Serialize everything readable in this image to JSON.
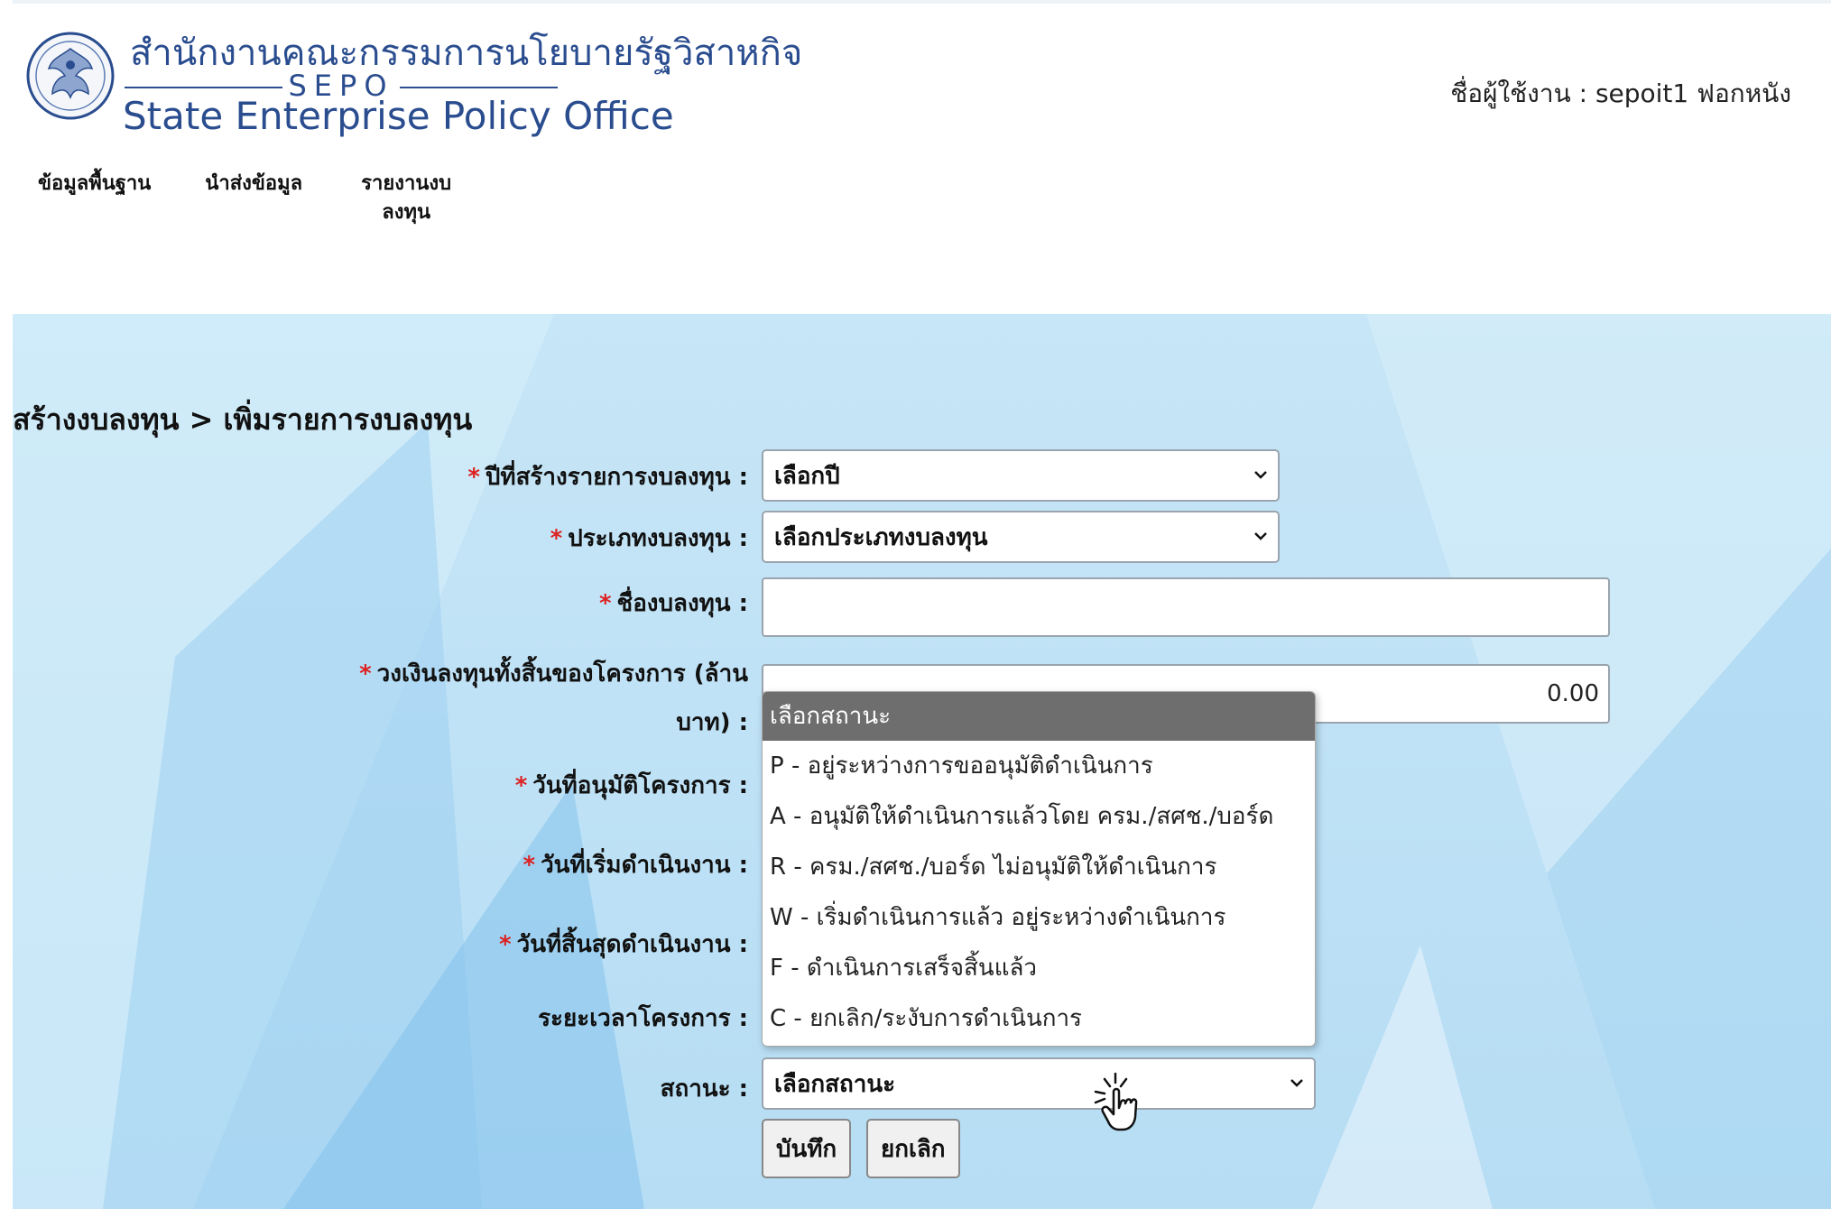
{
  "header": {
    "logo_thai": "สำนักงานคณะกรรมการนโยบายรัฐวิสาหกิจ",
    "logo_sepo": "SEPO",
    "logo_english": "State Enterprise Policy Office",
    "user_label": "ชื่อผู้ใช้งาน : sepoit1 ฟอกหนัง"
  },
  "nav": {
    "items": [
      {
        "label": "ข้อมูลพื้นฐาน"
      },
      {
        "label": "นำส่งข้อมูล"
      },
      {
        "label_line1": "รายงานงบ",
        "label_line2": "ลงทุน"
      }
    ]
  },
  "breadcrumb": "สร้างงบลงทุน > เพิ่มรายการงบลงทุน",
  "form": {
    "required_mark": "*",
    "year_label": "ปีที่สร้างรายการงบลงทุน :",
    "year_value": "เลือกปี",
    "type_label": "ประเภทงบลงทุน :",
    "type_value": "เลือกประเภทงบลงทุน",
    "name_label": "ชื่องบลงทุน :",
    "name_value": "",
    "budget_label_line1": "วงเงินลงทุนทั้งสิ้นของโครงการ (ล้าน",
    "budget_label_line2": "บาท) :",
    "budget_value": "0.00",
    "approve_date_label": "วันที่อนุมัติโครงการ :",
    "start_date_label": "วันที่เริ่มดำเนินงาน :",
    "end_date_label": "วันที่สิ้นสุดดำเนินงาน :",
    "duration_label": "ระยะเวลาโครงการ :",
    "status_label": "สถานะ :",
    "status_value": "เลือกสถานะ",
    "status_options": [
      "เลือกสถานะ",
      "P - อยู่ระหว่างการขออนุมัติดำเนินการ",
      "A - อนุมัติให้ดำเนินการแล้วโดย ครม./สศช./บอร์ด",
      "R - ครม./สศช./บอร์ด ไม่อนุมัติให้ดำเนินการ",
      "W - เริ่มดำเนินการแล้ว อยู่ระหว่างดำเนินการ",
      "F - ดำเนินการเสร็จสิ้นแล้ว",
      "C - ยกเลิก/ระงับการดำเนินการ"
    ],
    "save_button": "บันทึก",
    "cancel_button": "ยกเลิก"
  },
  "icons": {
    "logo": "sepo-seal-icon",
    "dropdown_arrow": "chevron-down-icon",
    "cursor": "hand-pointer-icon"
  },
  "colors": {
    "brand": "#2a4d8f",
    "required": "#dd2222",
    "background": "#c7e6f7",
    "dropdown_selected": "#6e6e6e"
  }
}
